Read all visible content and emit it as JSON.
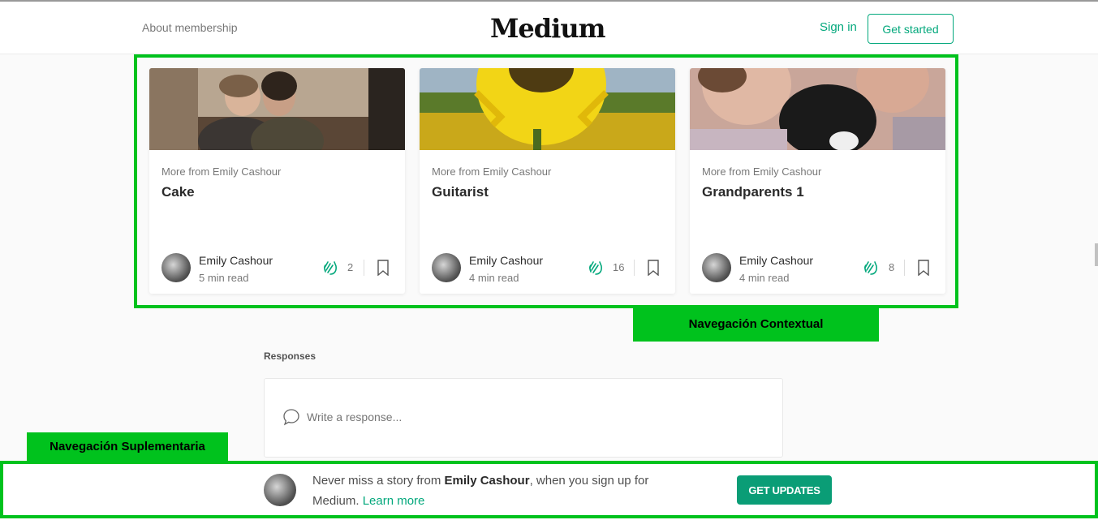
{
  "header": {
    "about_label": "About membership",
    "logo_text": "Medium",
    "signin_label": "Sign in",
    "getstarted_label": "Get started"
  },
  "annotations": {
    "contextual_label": "Navegación Contextual",
    "supplementary_label": "Navegación Suplementaria",
    "highlight_color": "#00c21d"
  },
  "cards": [
    {
      "more_from": "More from Emily Cashour",
      "title": "Cake",
      "author": "Emily Cashour",
      "read_time": "5 min read",
      "claps": "2"
    },
    {
      "more_from": "More from Emily Cashour",
      "title": "Guitarist",
      "author": "Emily Cashour",
      "read_time": "4 min read",
      "claps": "16"
    },
    {
      "more_from": "More from Emily Cashour",
      "title": "Grandparents 1",
      "author": "Emily Cashour",
      "read_time": "4 min read",
      "claps": "8"
    }
  ],
  "responses": {
    "title": "Responses",
    "placeholder": "Write a response..."
  },
  "footer_bar": {
    "text_before": "Never miss a story from ",
    "author": "Emily Cashour",
    "text_after": ", when you sign up for Medium. ",
    "link_label": "Learn more",
    "button_label": "GET UPDATES"
  },
  "colors": {
    "accent": "#03a87c",
    "button": "#0a9d76"
  },
  "icons": [
    "clap-icon",
    "bookmark-icon",
    "speech-bubble-icon"
  ]
}
